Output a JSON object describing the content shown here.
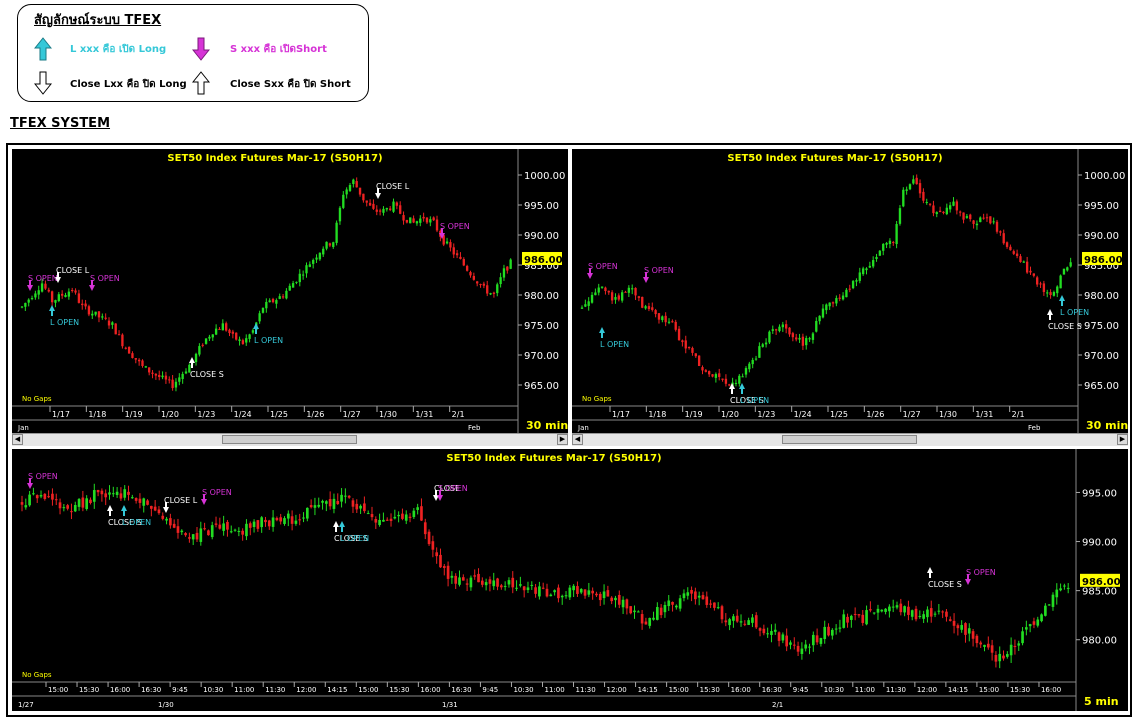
{
  "legend": {
    "title": "สัญลักษณ์ระบบ TFEX",
    "items": [
      {
        "text": "L xxx คือ เปิด Long",
        "color": "#35c8d8",
        "icon": "arrow-up-cyan-icon"
      },
      {
        "text": "S xxx คือ เปิดShort",
        "color": "#d633d6",
        "icon": "arrow-down-magenta-icon"
      },
      {
        "text": "Close Lxx คือ ปิด Long",
        "color": "#000000",
        "icon": "arrow-down-outline-icon"
      },
      {
        "text": "Close Sxx คือ ปิด Short",
        "color": "#000000",
        "icon": "arrow-up-outline-icon"
      }
    ]
  },
  "system_title": "TFEX SYSTEM",
  "colors": {
    "bg": "#000000",
    "title": "#ffff00",
    "up": "#22dd22",
    "down": "#ee2222",
    "long": "#35c8d8",
    "short": "#d633d6",
    "close": "#ffffff",
    "axis_text": "#ffffff",
    "price_tag": "#ffff00"
  },
  "charts": [
    {
      "title": "SET50  Index  Futures  Mar-17  (S50H17)",
      "gaps_label": "No  Gaps",
      "interval": "30  min",
      "last_price": "986.00",
      "y_ticks": [
        "1000.00",
        "995.00",
        "990.00",
        "985.00",
        "980.00",
        "975.00",
        "970.00",
        "965.00"
      ],
      "date_ticks": [
        "1/17",
        "1/18",
        "1/19",
        "1/20",
        "1/23",
        "1/24",
        "1/25",
        "1/26",
        "1/27",
        "1/30",
        "1/31",
        "2/1"
      ],
      "bottom_labels": [
        "Jan",
        "Feb"
      ],
      "signals": [
        {
          "label": "S  OPEN",
          "type": "short"
        },
        {
          "label": "CLOSE  L",
          "type": "close"
        },
        {
          "label": "S  OPEN",
          "type": "short"
        },
        {
          "label": "L  OPEN",
          "type": "long"
        },
        {
          "label": "CLOSE  S",
          "type": "close"
        },
        {
          "label": "L  OPEN",
          "type": "long"
        },
        {
          "label": "CLOSE  L",
          "type": "close"
        },
        {
          "label": "S  OPEN",
          "type": "short"
        }
      ]
    },
    {
      "title": "SET50  Index  Futures  Mar-17  (S50H17)",
      "gaps_label": "No  Gaps",
      "interval": "30  min",
      "last_price": "986.00",
      "y_ticks": [
        "1000.00",
        "995.00",
        "990.00",
        "985.00",
        "980.00",
        "975.00",
        "970.00",
        "965.00"
      ],
      "date_ticks": [
        "1/17",
        "1/18",
        "1/19",
        "1/20",
        "1/23",
        "1/24",
        "1/25",
        "1/26",
        "1/27",
        "1/30",
        "1/31",
        "2/1"
      ],
      "bottom_labels": [
        "Jan",
        "Feb"
      ],
      "signals": [
        {
          "label": "S  OPEN",
          "type": "short"
        },
        {
          "label": "L  OPEN",
          "type": "long"
        },
        {
          "label": "S  OPEN",
          "type": "short"
        },
        {
          "label": "CLOSE  S",
          "type": "close"
        },
        {
          "label": "L  OPEN",
          "type": "long"
        },
        {
          "label": "CLOSE  S",
          "type": "close"
        },
        {
          "label": "L  OPEN",
          "type": "long"
        }
      ]
    },
    {
      "title": "SET50  Index  Futures  Mar-17  (S50H17)",
      "gaps_label": "No  Gaps",
      "interval": "5  min",
      "last_price": "986.00",
      "y_ticks": [
        "995.00",
        "990.00",
        "985.00",
        "980.00"
      ],
      "time_ticks": [
        "15:00",
        "15:30",
        "16:00",
        "16:30",
        "9:45",
        "10:30",
        "11:00",
        "11:30",
        "12:00",
        "14:15",
        "15:00",
        "15:30",
        "16:00",
        "16:30",
        "9:45",
        "10:30",
        "11:00",
        "11:30",
        "12:00",
        "14:15",
        "15:00",
        "15:30",
        "16:00",
        "16:30",
        "9:45",
        "10:30",
        "11:00",
        "11:30",
        "12:00",
        "14:15",
        "15:00",
        "15:30",
        "16:00"
      ],
      "bottom_labels": [
        "1/27",
        "1/30",
        "1/31",
        "2/1"
      ],
      "signals": [
        {
          "label": "S  OPEN",
          "type": "short"
        },
        {
          "label": "CLOSE  S",
          "type": "close"
        },
        {
          "label": "L  OPEN",
          "type": "long"
        },
        {
          "label": "CLOSE  L",
          "type": "close"
        },
        {
          "label": "S  OPEN",
          "type": "short"
        },
        {
          "label": "CLOSE  S",
          "type": "close"
        },
        {
          "label": "L  OPEN",
          "type": "long"
        },
        {
          "label": "CLOSE",
          "type": "close"
        },
        {
          "label": "S  OPEN",
          "type": "short"
        },
        {
          "label": "CLOSE  S",
          "type": "close"
        },
        {
          "label": "S  OPEN",
          "type": "short"
        }
      ]
    }
  ],
  "chart_data": [
    {
      "type": "candlestick",
      "title": "SET50  Index  Futures  Mar-17  (S50H17)",
      "interval": "30  min",
      "ylim": [
        962,
        1002
      ],
      "x_range": [
        "1/16",
        "2/1"
      ],
      "close_path": [
        978,
        980,
        982,
        979,
        980,
        981,
        978,
        977,
        976,
        975,
        972,
        970,
        968,
        967,
        966,
        965,
        967,
        969,
        972,
        974,
        975,
        973,
        972,
        974,
        978,
        979,
        980,
        982,
        984,
        986,
        988,
        989,
        997,
        999,
        996,
        994,
        994,
        995,
        993,
        992,
        993,
        992,
        989,
        987,
        985,
        983,
        981,
        980,
        984,
        986
      ]
    },
    {
      "type": "candlestick",
      "title": "SET50  Index  Futures  Mar-17  (S50H17)",
      "interval": "30  min",
      "ylim": [
        962,
        1002
      ],
      "x_range": [
        "1/16",
        "2/1"
      ],
      "close_path": [
        978,
        980,
        982,
        979,
        980,
        981,
        978,
        977,
        976,
        975,
        972,
        970,
        968,
        967,
        966,
        965,
        967,
        969,
        972,
        974,
        975,
        973,
        972,
        974,
        978,
        979,
        980,
        982,
        984,
        986,
        988,
        989,
        997,
        999,
        996,
        994,
        994,
        995,
        993,
        992,
        993,
        992,
        989,
        987,
        985,
        983,
        981,
        980,
        984,
        986
      ]
    },
    {
      "type": "candlestick",
      "title": "SET50  Index  Futures  Mar-17  (S50H17)",
      "interval": "5  min",
      "ylim": [
        976,
        998
      ],
      "x_range": [
        "1/27",
        "2/1"
      ],
      "close_path": [
        994,
        994.5,
        994,
        993.5,
        994,
        995,
        994.5,
        995,
        994,
        993,
        991,
        990.5,
        991,
        991.5,
        991,
        991.5,
        992,
        992,
        992.5,
        993,
        994,
        994.5,
        993.5,
        992.5,
        992,
        992.5,
        993,
        989,
        986,
        986,
        986,
        985.5,
        985.5,
        985,
        985,
        984.5,
        985,
        985,
        984.5,
        984,
        983,
        982,
        983,
        984,
        984.5,
        983.5,
        982.5,
        982,
        982,
        981,
        980,
        979,
        980,
        981,
        982,
        982,
        983,
        983.5,
        983,
        982.5,
        983,
        982,
        981,
        980,
        978,
        979,
        981,
        983,
        985,
        986
      ]
    }
  ]
}
